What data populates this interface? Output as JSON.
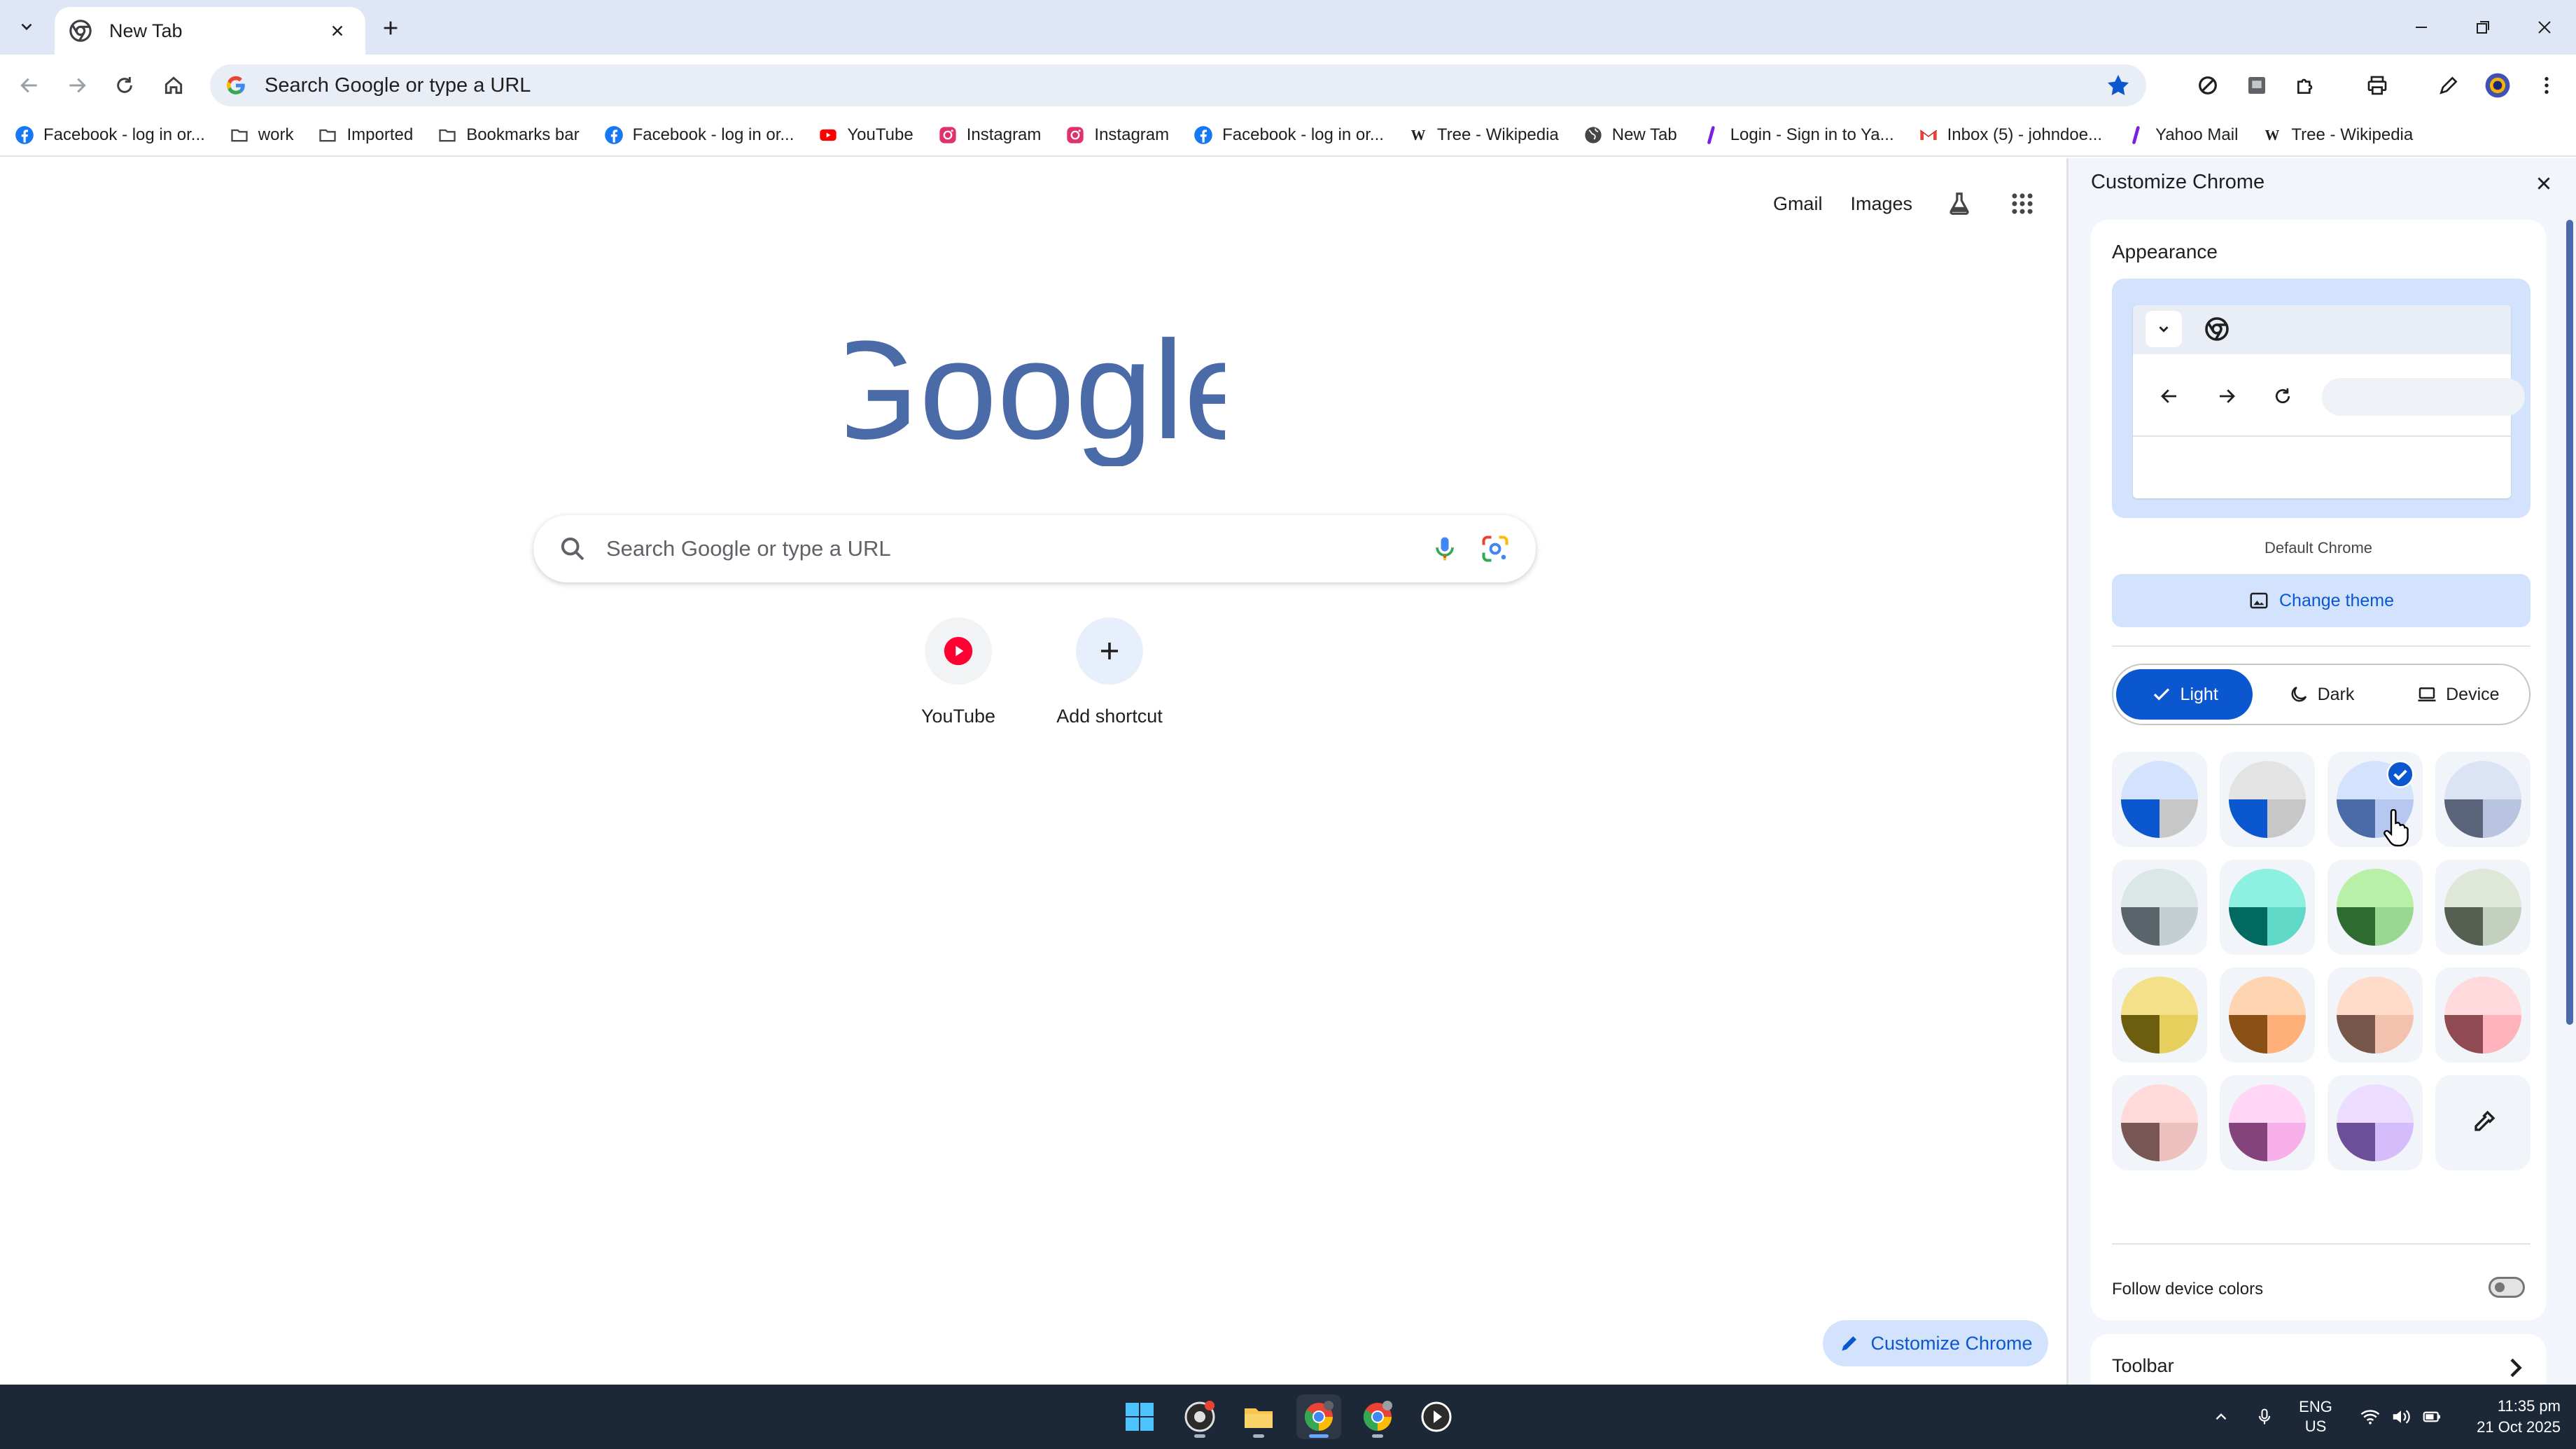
{
  "browser": {
    "tab_title": "New Tab",
    "omnibox_placeholder": "Search Google or type a URL"
  },
  "bookmarks": [
    {
      "label": "Facebook - log in or...",
      "icon": "facebook-icon"
    },
    {
      "label": "work",
      "icon": "folder-icon"
    },
    {
      "label": "Imported",
      "icon": "folder-icon"
    },
    {
      "label": "Bookmarks bar",
      "icon": "folder-icon"
    },
    {
      "label": "Facebook - log in or...",
      "icon": "facebook-icon"
    },
    {
      "label": "YouTube",
      "icon": "youtube-icon"
    },
    {
      "label": "Instagram",
      "icon": "instagram-icon"
    },
    {
      "label": "Instagram",
      "icon": "instagram-icon"
    },
    {
      "label": "Facebook - log in or...",
      "icon": "facebook-icon"
    },
    {
      "label": "Tree - Wikipedia",
      "icon": "wikipedia-icon"
    },
    {
      "label": "New Tab",
      "icon": "globe-icon"
    },
    {
      "label": "Login - Sign in to Ya...",
      "icon": "yahoo-icon"
    },
    {
      "label": "Inbox (5) - johndoe...",
      "icon": "gmail-icon"
    },
    {
      "label": "Yahoo Mail",
      "icon": "yahoo-icon"
    },
    {
      "label": "Tree - Wikipedia",
      "icon": "wikipedia-icon"
    }
  ],
  "ntp": {
    "gmail": "Gmail",
    "images": "Images",
    "logo_text": "Google",
    "search_placeholder": "Search Google or type a URL",
    "shortcuts": [
      {
        "label": "YouTube",
        "icon": "youtube-icon"
      },
      {
        "label": "Add shortcut",
        "icon": "plus-icon"
      }
    ],
    "customize_button": "Customize Chrome"
  },
  "side_panel": {
    "title": "Customize Chrome",
    "appearance_title": "Appearance",
    "theme_name": "Default Chrome",
    "change_theme": "Change theme",
    "modes": [
      "Light",
      "Dark",
      "Device"
    ],
    "selected_mode": "Light",
    "swatches": [
      {
        "top": "#d3e3fd",
        "left": "#0b57d0",
        "right": "#c7c7c7"
      },
      {
        "top": "#e3e3e3",
        "left": "#0b57d0",
        "right": "#c7c7c7"
      },
      {
        "top": "#d3e3fd",
        "left": "#4a6aa8",
        "right": "#b6c8f0",
        "selected": true
      },
      {
        "top": "#dbe3f5",
        "left": "#5a647a",
        "right": "#b8c4e0"
      },
      {
        "top": "#dbe6e6",
        "left": "#59656a",
        "right": "#c3cfd0"
      },
      {
        "top": "#8ef0e0",
        "left": "#006a60",
        "right": "#5fd8c8"
      },
      {
        "top": "#b8f0a8",
        "left": "#2e6b30",
        "right": "#98d890"
      },
      {
        "top": "#dfe8d8",
        "left": "#566052",
        "right": "#c3d0bd"
      },
      {
        "top": "#f5e08a",
        "left": "#6d5e0f",
        "right": "#e6cf5c"
      },
      {
        "top": "#ffd4b0",
        "left": "#8a5016",
        "right": "#ffb078"
      },
      {
        "top": "#ffdbca",
        "left": "#77574a",
        "right": "#f2c2ae"
      },
      {
        "top": "#ffd9dc",
        "left": "#904a51",
        "right": "#ffb3ba"
      },
      {
        "top": "#ffdad8",
        "left": "#775654",
        "right": "#ecc0bd"
      },
      {
        "top": "#ffd6f6",
        "left": "#84437a",
        "right": "#f8b0ea"
      },
      {
        "top": "#ecdcff",
        "left": "#6b4f99",
        "right": "#d5bdfc"
      },
      {
        "custom": true,
        "icon": "eyedropper-icon"
      }
    ],
    "follow_device_colors": "Follow device colors",
    "follow_device_enabled": false,
    "toolbar_section": "Toolbar"
  },
  "taskbar": {
    "lang_top": "ENG",
    "lang_bottom": "US",
    "time": "11:35 pm",
    "date": "21 Oct 2025"
  },
  "colors": {
    "accent": "#0b57d0",
    "tabstrip": "#dfe6f6",
    "taskbar": "#1c2737",
    "logo": "#4a6aa8"
  }
}
